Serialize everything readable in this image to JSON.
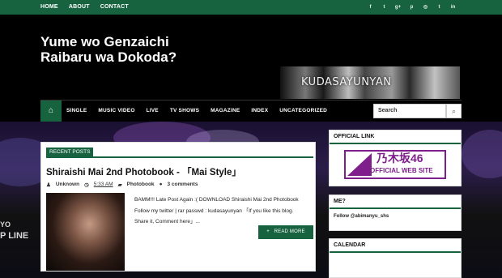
{
  "topnav": [
    "HOME",
    "ABOUT",
    "CONTACT"
  ],
  "social_icons": [
    {
      "icon": "facebook-icon",
      "glyph": "f"
    },
    {
      "icon": "twitter-icon",
      "glyph": "t"
    },
    {
      "icon": "google-plus-icon",
      "glyph": "g+"
    },
    {
      "icon": "pinterest-icon",
      "glyph": "p"
    },
    {
      "icon": "instagram-icon",
      "glyph": "◎"
    },
    {
      "icon": "tumblr-icon",
      "glyph": "t"
    },
    {
      "icon": "linkedin-icon",
      "glyph": "in"
    }
  ],
  "site_title": "Yume wo Genzaichi Raibaru wa Dokoda?",
  "banner_text": "KUDASAYUNYAN",
  "mainnav": [
    "SINGLE",
    "MUSIC VIDEO",
    "LIVE",
    "TV SHOWS",
    "MAGAZINE",
    "INDEX",
    "UNCATEGORIZED"
  ],
  "search": {
    "placeholder": "Search"
  },
  "background_text": [
    "YO",
    "P LINE"
  ],
  "recent_posts_label": "RECENT POSTS",
  "post": {
    "title": "Shiraishi Mai 2nd Photobook - 「Mai Style」",
    "author": "Unknown",
    "time": "5:33 AM",
    "category": "Photobook",
    "comments": "3 comments",
    "excerpt_lines": [
      "BAMM!!! Late Post Again :( DOWNLOAD Shiraishi Mai 2nd Photobook",
      "Follow my twitter | rar passwd : kudasayunyan 「If you like this blog.",
      "Share it, Comment here」..."
    ],
    "read_more": "READ MORE"
  },
  "sidebar": {
    "official_link_title": "OFFICIAL LINK",
    "logo_jp": "乃木坂46",
    "logo_en": "OFFICIAL WEB SITE",
    "me_title": "ME?",
    "follow_text": "Follow @abimanyu_shs",
    "calendar_title": "CALENDAR"
  },
  "colors": {
    "accent": "#17633f",
    "logo": "#7e1f8c"
  }
}
